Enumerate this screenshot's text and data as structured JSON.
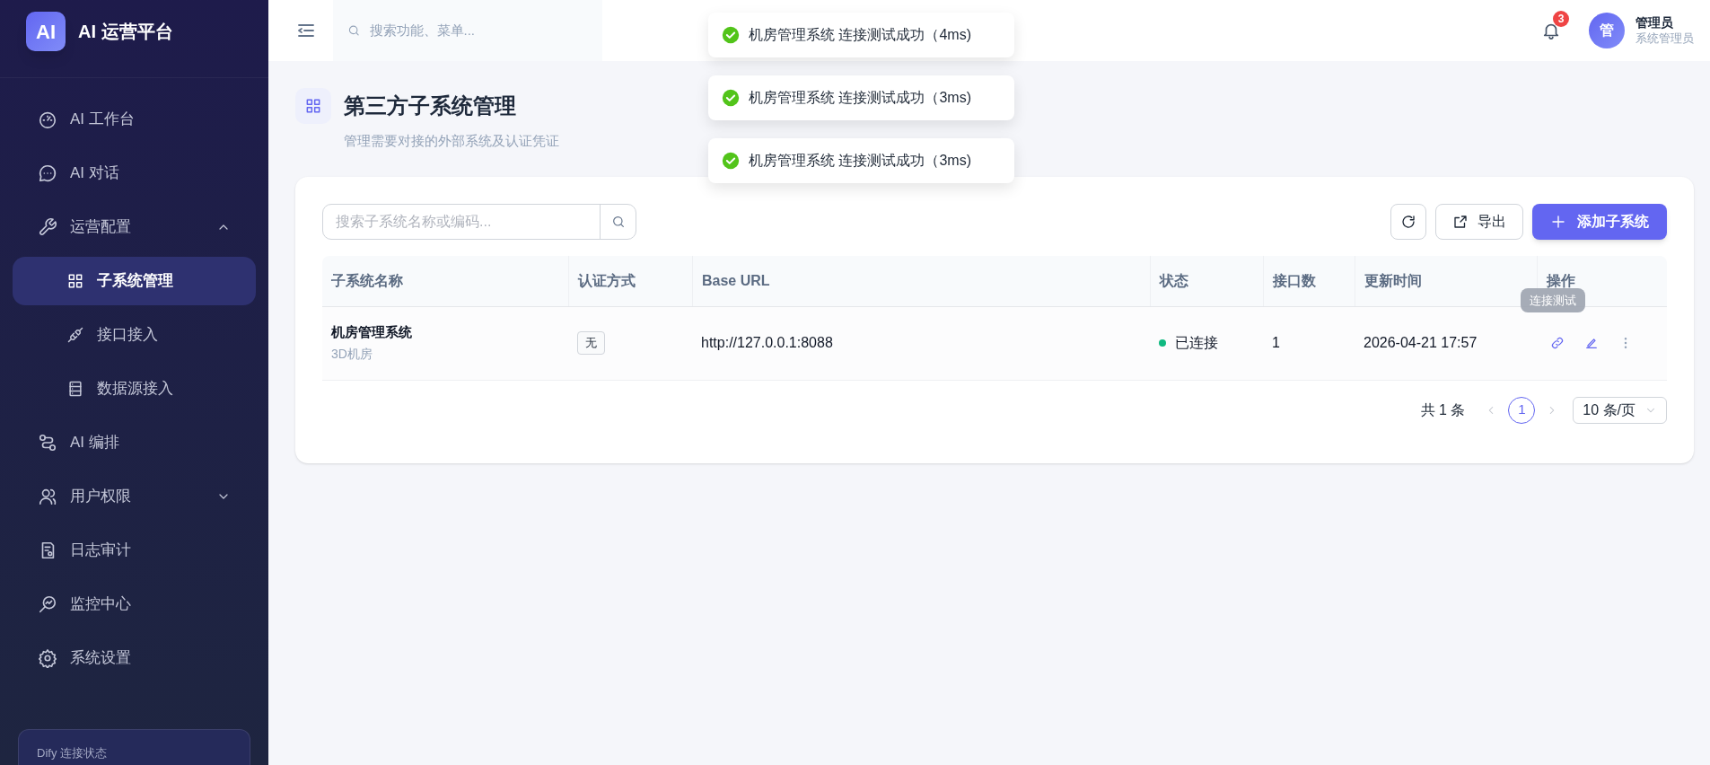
{
  "app": {
    "logo": "AI",
    "title": "AI 运营平台"
  },
  "sidebar": {
    "items": [
      {
        "label": "AI 工作台",
        "kind": "link",
        "selected": false
      },
      {
        "label": "AI 对话",
        "kind": "link",
        "selected": false
      },
      {
        "label": "运营配置",
        "kind": "group",
        "selected": false,
        "expanded": true,
        "children": [
          {
            "label": "子系统管理",
            "selected": true
          },
          {
            "label": "接口接入",
            "selected": false
          },
          {
            "label": "数据源接入",
            "selected": false
          }
        ]
      },
      {
        "label": "AI 编排",
        "kind": "link",
        "selected": false
      },
      {
        "label": "用户权限",
        "kind": "group",
        "selected": false,
        "expanded": false
      },
      {
        "label": "日志审计",
        "kind": "link",
        "selected": false
      },
      {
        "label": "监控中心",
        "kind": "link",
        "selected": false
      },
      {
        "label": "系统设置",
        "kind": "link",
        "selected": false
      }
    ],
    "status_panel": {
      "label": "Dify 连接状态"
    }
  },
  "topbar": {
    "search": {
      "placeholder": "搜索功能、菜单..."
    },
    "notifications": "3",
    "user": {
      "avatar": "管",
      "name": "管理员",
      "role": "系统管理员"
    }
  },
  "toasts": [
    {
      "kind": "success",
      "message": "机房管理系统 连接测试成功（4ms)"
    },
    {
      "kind": "success",
      "message": "机房管理系统 连接测试成功（3ms)"
    },
    {
      "kind": "success",
      "message": "机房管理系统 连接测试成功（3ms)"
    }
  ],
  "page": {
    "title": "第三方子系统管理",
    "subtitle": "管理需要对接的外部系统及认证凭证"
  },
  "toolbar": {
    "search": {
      "placeholder": "搜索子系统名称或编码..."
    },
    "export": "导出",
    "add": "添加子系统"
  },
  "table": {
    "columns": [
      "子系统名称",
      "认证方式",
      "Base URL",
      "状态",
      "接口数",
      "更新时间",
      "操作"
    ],
    "rows": [
      {
        "name": "机房管理系统",
        "code": "3D机房",
        "auth": "无",
        "base_url": "http://127.0.0.1:8088",
        "status": {
          "text": "已连接",
          "color": "#10b981"
        },
        "interfaces": "1",
        "updated": "2026-04-21 17:57",
        "tooltip": "连接测试"
      }
    ]
  },
  "pagination": {
    "total": "共 1 条",
    "pages": [
      {
        "label": "1",
        "selected": true
      }
    ],
    "page_size": "10 条/页"
  }
}
